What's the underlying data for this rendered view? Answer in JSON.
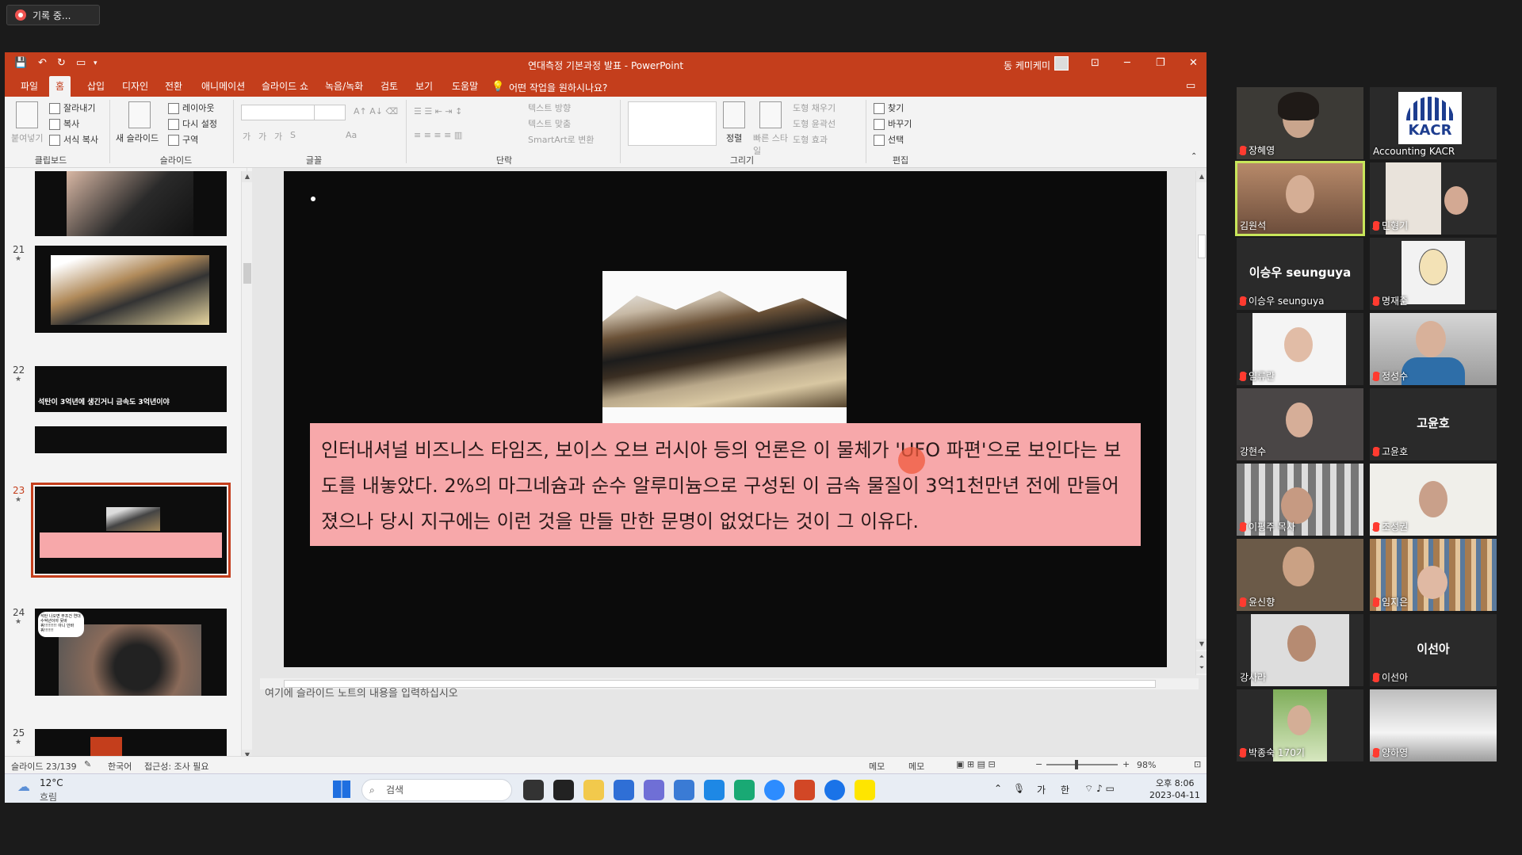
{
  "recording": {
    "label": "기록 중..."
  },
  "window": {
    "title": "연대측정 기본과정 발표  -  PowerPoint",
    "user": "동 케미케미"
  },
  "tabs": [
    "파일",
    "홈",
    "삽입",
    "디자인",
    "전환",
    "애니메이션",
    "슬라이드 쇼",
    "녹음/녹화",
    "검토",
    "보기",
    "도움말"
  ],
  "tell_me": "어떤 작업을 원하시나요?",
  "ribbon": {
    "clipboard": {
      "paste": "붙여넣기",
      "cut": "잘라내기",
      "copy": "복사",
      "format_painter": "서식 복사",
      "group": "클립보드"
    },
    "slides": {
      "new_slide": "새 슬라이드",
      "layout": "레이아웃",
      "reset": "다시 설정",
      "section": "구역",
      "group": "슬라이드"
    },
    "font": {
      "group": "글꼴",
      "bold": "가",
      "italic": "가",
      "underline": "가",
      "strike": "S",
      "char_spacing": "Aa"
    },
    "paragraph": {
      "text_direction": "텍스트 방향",
      "align_text": "텍스트 맞춤",
      "smartart": "SmartArt로 변환",
      "group": "단락"
    },
    "drawing": {
      "arrange": "정렬",
      "quick_styles": "빠른 스타일",
      "fill": "도형 채우기",
      "outline": "도형 윤곽선",
      "effects": "도형 효과",
      "group": "그리기"
    },
    "editing": {
      "find": "찾기",
      "replace": "바꾸기",
      "select": "선택",
      "group": "편집"
    }
  },
  "thumbnails": [
    {
      "num": "21"
    },
    {
      "num": "22",
      "headline": "석탄이 3억년에 생긴거니 금속도 3억년이야"
    },
    {
      "num": "23"
    },
    {
      "num": "24",
      "bubble": "석탄 나오면 무조건 연대 수억년이야 못바꿔!!!!!!!! 아니 안바꿔!!!!!!"
    },
    {
      "num": "25"
    }
  ],
  "slide": {
    "caption": "인터내셔널 비즈니스 타임즈, 보이스 오브 러시아 등의 언론은 이 물체가 'UFO 파편'으로 보인다는 보도를 내놓았다. 2%의 마그네슘과 순수 알루미늄으로 구성된 이 금속 물질이 3억1천만년 전에 만들어 졌으나 당시 지구에는 이런 것을 만들 만한 문명이 없었다는 것이 그 이유다."
  },
  "notes_placeholder": "여기에 슬라이드 노트의 내용을 입력하십시오",
  "status": {
    "slide_counter": "슬라이드 23/139",
    "language": "한국어",
    "accessibility": "접근성: 조사 필요",
    "notes": "메모",
    "comments": "메모",
    "zoom": "98%"
  },
  "taskbar": {
    "weather_temp": "12°C",
    "weather_desc": "흐림",
    "search": "검색",
    "ime1": "가",
    "ime2": "한",
    "time": "오후 8:06",
    "date": "2023-04-11"
  },
  "participants": [
    {
      "name": "장혜영"
    },
    {
      "name": "Accounting KACR",
      "logo": "KACR"
    },
    {
      "name": "김원석",
      "active": true
    },
    {
      "name": "민형기"
    },
    {
      "name": "이승우 seunguya",
      "big": "이승우 seunguya"
    },
    {
      "name": "명재준"
    },
    {
      "name": "임류란"
    },
    {
      "name": "정성수"
    },
    {
      "name": "강현수"
    },
    {
      "name": "고윤호",
      "big": "고윤호"
    },
    {
      "name": "이평주 목사"
    },
    {
      "name": "조성권"
    },
    {
      "name": "윤신향"
    },
    {
      "name": "임지은"
    },
    {
      "name": "강사라"
    },
    {
      "name": "이선아",
      "big": "이선아"
    },
    {
      "name": "박종숙 170기"
    },
    {
      "name": "양하영"
    }
  ],
  "colors": {
    "ppt_accent": "#c43e1c",
    "caption_bg": "#f7a8aa",
    "active_speaker": "#c8e65a",
    "mute": "#ff3b30"
  }
}
